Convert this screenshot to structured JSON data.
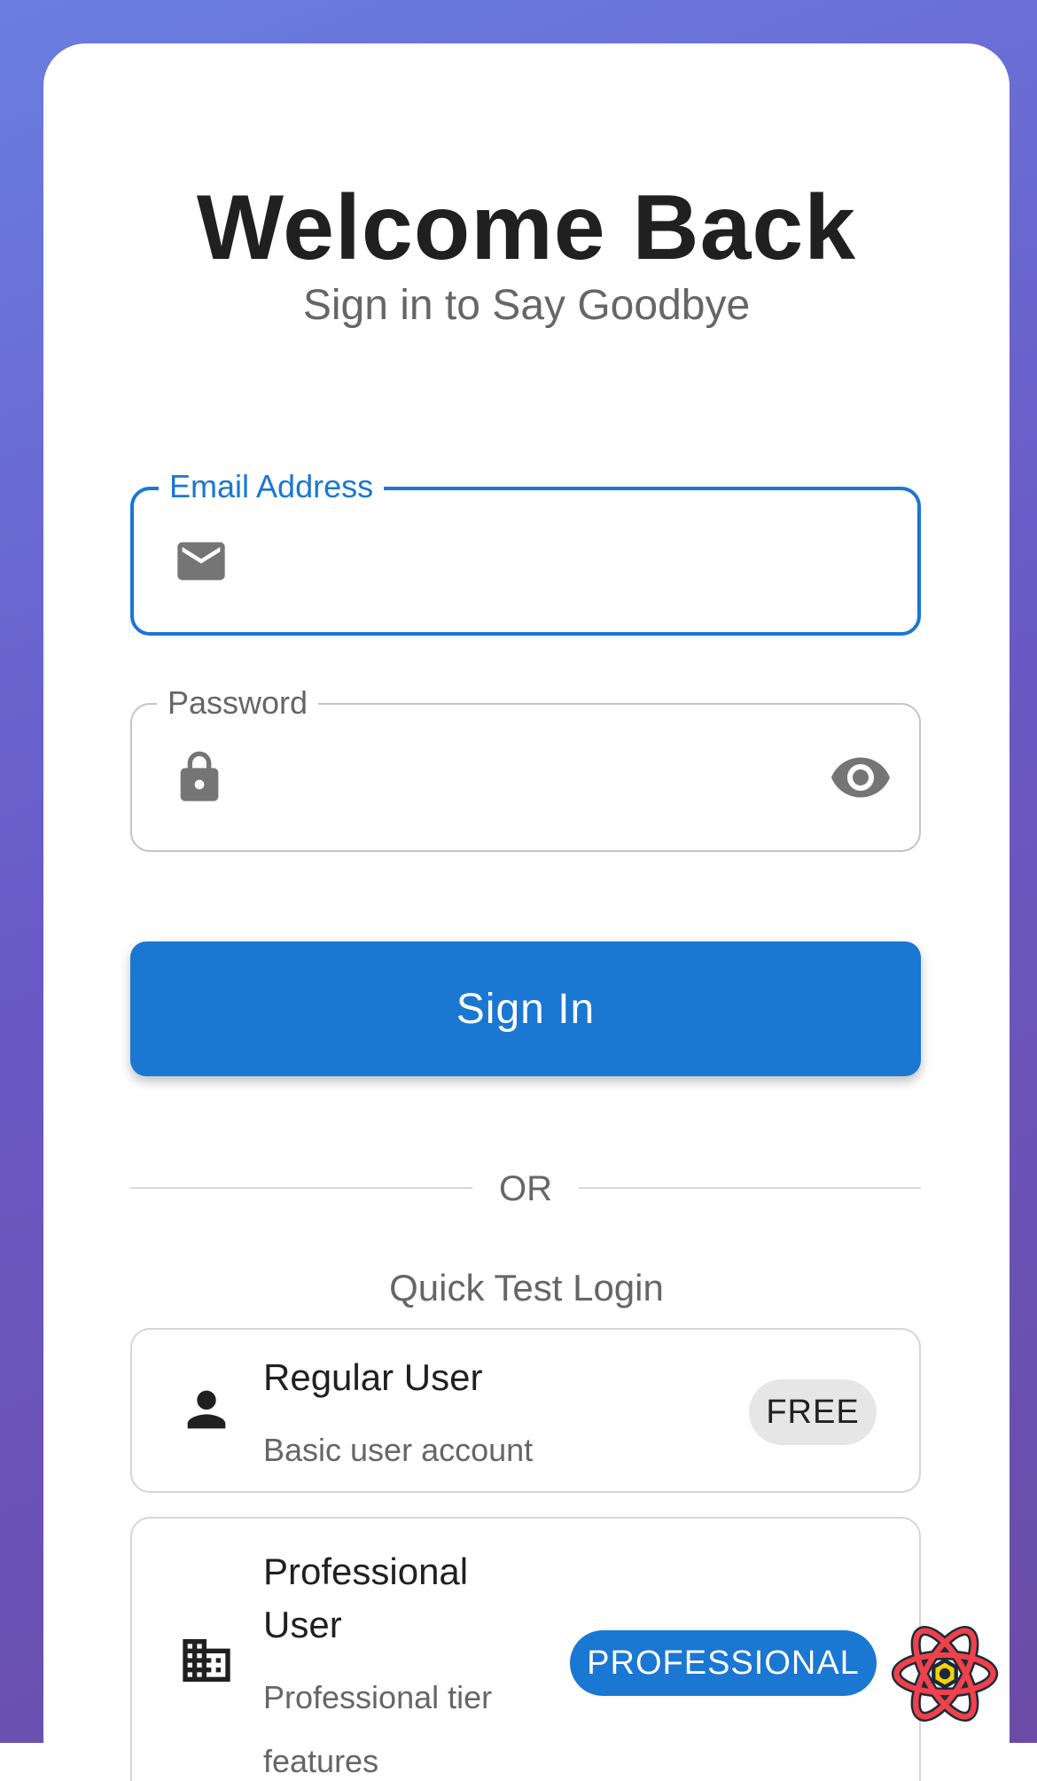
{
  "header": {
    "title": "Welcome Back",
    "subtitle": "Sign in to Say Goodbye"
  },
  "form": {
    "email": {
      "label": "Email Address",
      "value": "",
      "icon": "mail-icon"
    },
    "password": {
      "label": "Password",
      "value": "",
      "icon": "lock-icon",
      "toggle_icon": "eye-icon"
    },
    "submit_label": "Sign In"
  },
  "divider": {
    "text": "OR"
  },
  "quick_login": {
    "title": "Quick Test Login",
    "users": [
      {
        "name": "Regular User",
        "description": "Basic user account",
        "badge": "FREE",
        "icon": "person-icon"
      },
      {
        "name": "Professional User",
        "description": "Professional tier features",
        "badge": "PROFESSIONAL",
        "icon": "building-icon"
      }
    ]
  },
  "colors": {
    "primary": "#1a77d2",
    "background_gradient_start": "#6a7ee0",
    "background_gradient_end": "#6a4ca6",
    "badge_free_bg": "#e6e6e6"
  },
  "overlay": {
    "devtools_icon": "react-devtools-icon"
  }
}
